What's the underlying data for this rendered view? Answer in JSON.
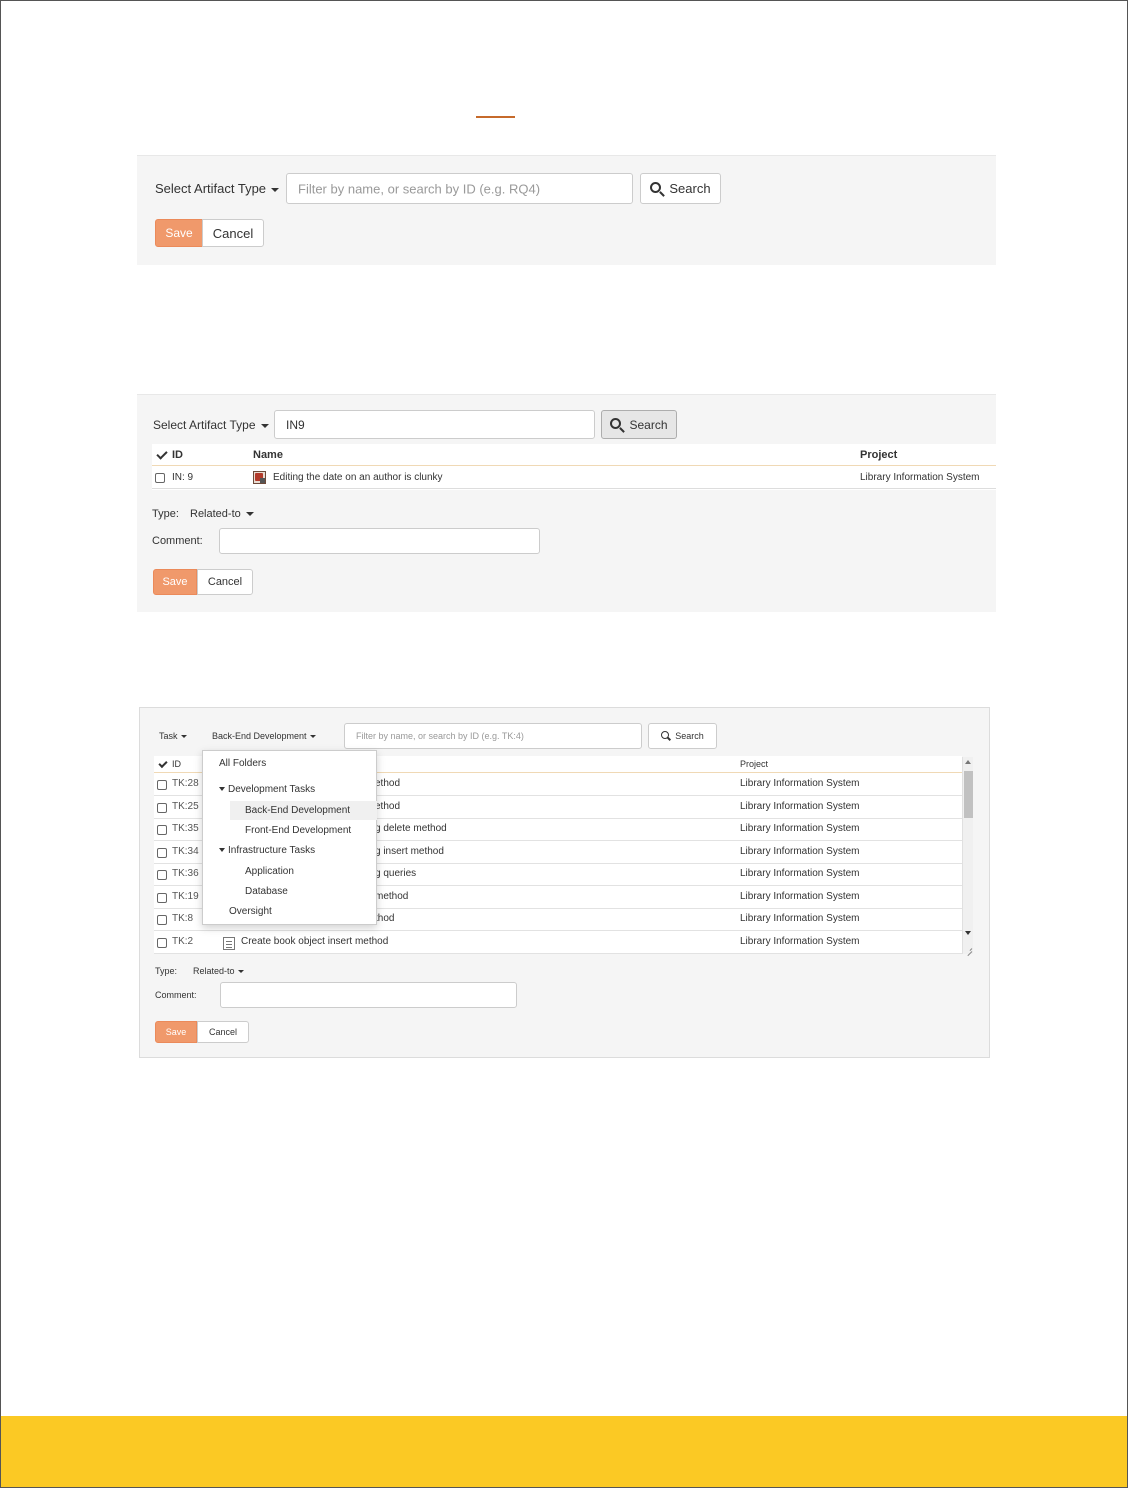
{
  "panel1": {
    "artifact_type_label": "Select Artifact Type",
    "search_placeholder": "Filter by name, or search by ID (e.g. RQ4)",
    "search_button": "Search",
    "save_button": "Save",
    "cancel_button": "Cancel"
  },
  "panel2": {
    "artifact_type_label": "Select Artifact Type",
    "search_value": "IN9",
    "search_button": "Search",
    "columns": {
      "id": "ID",
      "name": "Name",
      "project": "Project"
    },
    "rows": [
      {
        "id": "IN: 9",
        "name": "Editing the date on an author is clunky",
        "project": "Library Information System",
        "icon": "incident-icon"
      }
    ],
    "type_label": "Type:",
    "type_value": "Related-to",
    "comment_label": "Comment:",
    "save_button": "Save",
    "cancel_button": "Cancel"
  },
  "panel3": {
    "artifact_type_label": "Task",
    "folder_label": "Back-End Development",
    "search_placeholder": "Filter by name, or search by ID (e.g. TK:4)",
    "search_button": "Search",
    "columns": {
      "id": "ID",
      "project": "Project"
    },
    "rows": [
      {
        "id": "TK:28",
        "name": "ethod",
        "project": "Library Information System"
      },
      {
        "id": "TK:25",
        "name": "ethod",
        "project": "Library Information System"
      },
      {
        "id": "TK:35",
        "name": "g delete method",
        "project": "Library Information System"
      },
      {
        "id": "TK:34",
        "name": "g insert method",
        "project": "Library Information System"
      },
      {
        "id": "TK:36",
        "name": "g queries",
        "project": "Library Information System"
      },
      {
        "id": "TK:19",
        "name": "method",
        "project": "Library Information System"
      },
      {
        "id": "TK:8",
        "name": "thod",
        "project": "Library Information System"
      },
      {
        "id": "TK:2",
        "name": "Create book object insert method",
        "project": "Library Information System"
      }
    ],
    "folders": {
      "all": "All Folders",
      "dev": "Development Tasks",
      "backend": "Back-End Development",
      "frontend": "Front-End Development",
      "infra": "Infrastructure Tasks",
      "application": "Application",
      "database": "Database",
      "oversight": "Oversight"
    },
    "type_label": "Type:",
    "type_value": "Related-to",
    "comment_label": "Comment:",
    "save_button": "Save",
    "cancel_button": "Cancel"
  },
  "colors": {
    "accent": "#c66a2b",
    "save": "#f0996b",
    "footer": "#fbc924",
    "panel_bg": "#f5f5f5"
  }
}
